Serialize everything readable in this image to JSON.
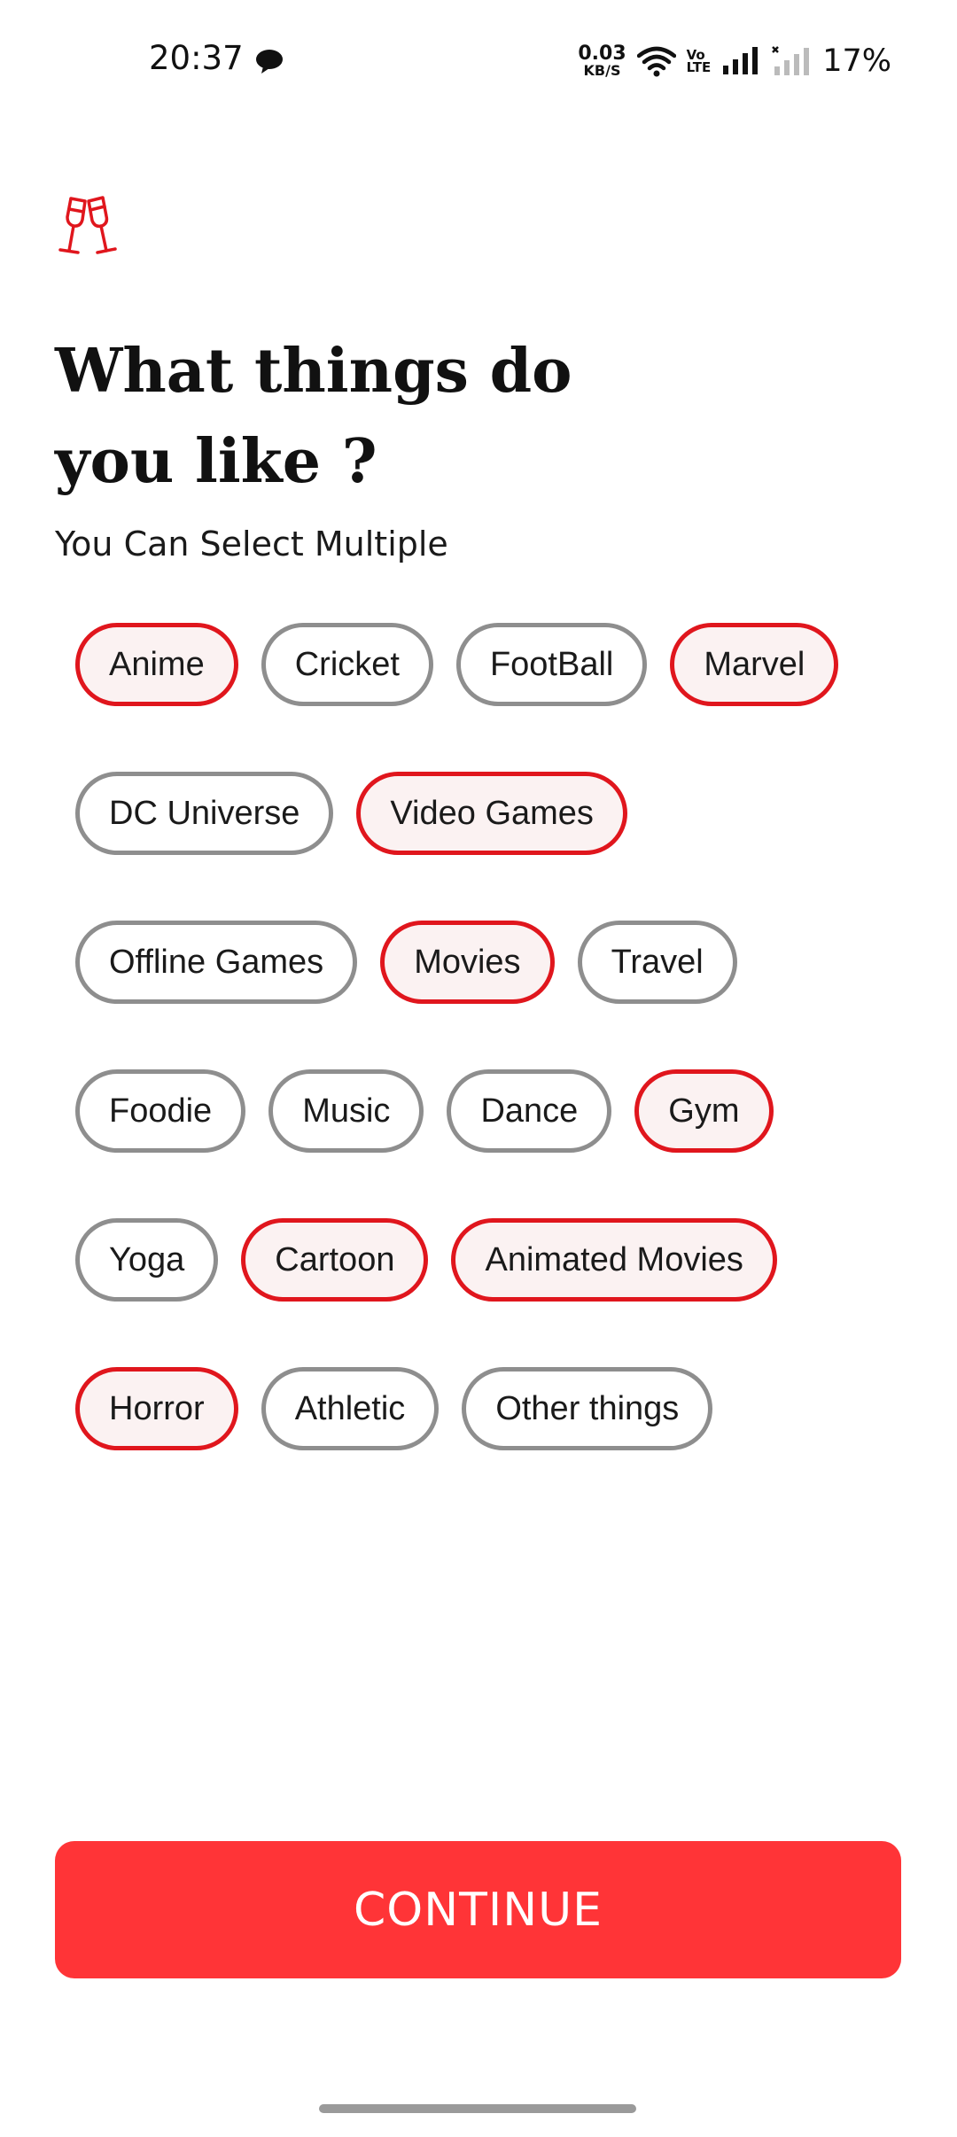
{
  "status_bar": {
    "time": "20:37",
    "net_speed_value": "0.03",
    "net_speed_unit": "KB/S",
    "volte_top": "Vo",
    "volte_bottom": "LTE",
    "battery": "17%"
  },
  "header": {
    "icon": "cheers-glasses-icon",
    "title_line1": "What things do",
    "title_line2": "you like ?",
    "subtitle": "You Can Select Multiple"
  },
  "chip_rows": [
    [
      {
        "label": "Anime",
        "selected": true
      },
      {
        "label": "Cricket",
        "selected": false
      },
      {
        "label": "FootBall",
        "selected": false
      },
      {
        "label": "Marvel",
        "selected": true
      }
    ],
    [
      {
        "label": "DC Universe",
        "selected": false
      },
      {
        "label": "Video Games",
        "selected": true
      }
    ],
    [
      {
        "label": "Offline Games",
        "selected": false
      },
      {
        "label": "Movies",
        "selected": true
      },
      {
        "label": "Travel",
        "selected": false
      }
    ],
    [
      {
        "label": "Foodie",
        "selected": false
      },
      {
        "label": "Music",
        "selected": false
      },
      {
        "label": "Dance",
        "selected": false
      },
      {
        "label": "Gym",
        "selected": true
      }
    ],
    [
      {
        "label": "Yoga",
        "selected": false
      },
      {
        "label": "Cartoon",
        "selected": true
      },
      {
        "label": "Animated Movies",
        "selected": true
      }
    ],
    [
      {
        "label": "Horror",
        "selected": true
      },
      {
        "label": "Athletic",
        "selected": false
      },
      {
        "label": "Other things",
        "selected": false
      }
    ]
  ],
  "continue_label": "CONTINUE",
  "colors": {
    "accent": "#e0161d",
    "button": "#ff3437",
    "chip_selected_bg": "#fbf2f2",
    "chip_border": "#8e8e8e"
  }
}
